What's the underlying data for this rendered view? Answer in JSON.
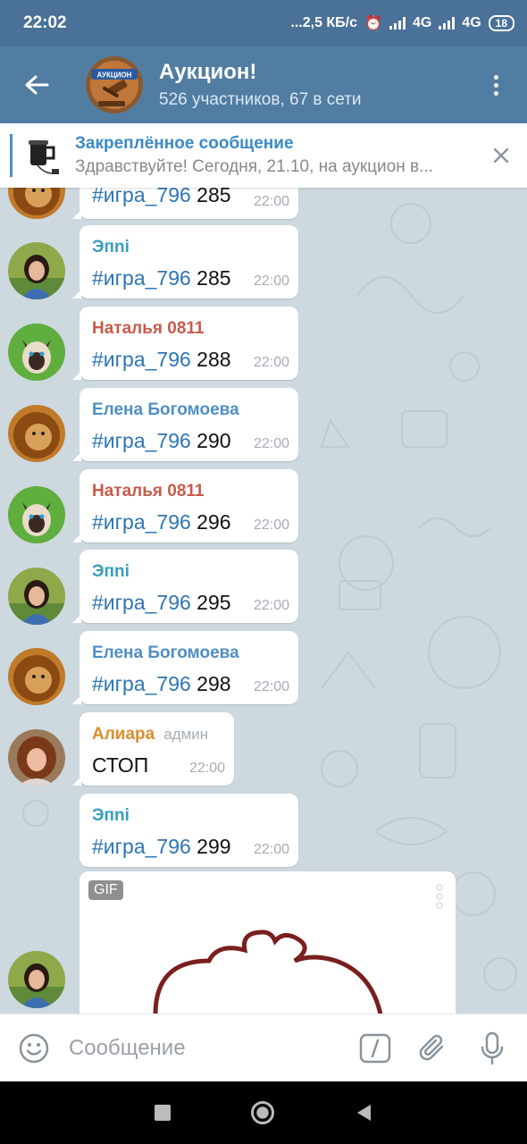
{
  "status_bar": {
    "time": "22:02",
    "net_speed": "...2,5 КБ/с",
    "net1": "4G",
    "net2": "4G",
    "battery": "18"
  },
  "header": {
    "title": "Аукцион!",
    "subtitle": "526 участников, 67 в сети",
    "avatar_text": "АУКЦИОН"
  },
  "pinned": {
    "title": "Закреплённое сообщение",
    "text": "Здравствуйте! Сегодня, 21.10, на аукцион в..."
  },
  "messages": [
    {
      "tag": "#игра_796",
      "value": "285",
      "time": "22:00"
    },
    {
      "sender": "Эпni",
      "tag": "#игра_796",
      "value": "285",
      "time": "22:00"
    },
    {
      "sender": "Наталья 0811",
      "tag": "#игра_796",
      "value": "288",
      "time": "22:00"
    },
    {
      "sender": "Елена Богомоева",
      "tag": "#игра_796",
      "value": "290",
      "time": "22:00"
    },
    {
      "sender": "Наталья 0811",
      "tag": "#игра_796",
      "value": "296",
      "time": "22:00"
    },
    {
      "sender": "Эпni",
      "tag": "#игра_796",
      "value": "295",
      "time": "22:00"
    },
    {
      "sender": "Елена Богомоева",
      "tag": "#игра_796",
      "value": "298",
      "time": "22:00"
    },
    {
      "sender": "Алиара",
      "role": "админ",
      "text": "СТОП",
      "time": "22:00"
    },
    {
      "sender": "Эпni",
      "tag": "#игра_796",
      "value": "299",
      "time": "22:00"
    }
  ],
  "gif": {
    "badge": "GIF"
  },
  "input": {
    "placeholder": "Сообщение"
  },
  "colors": {
    "header_bg": "#517da2",
    "status_bg": "#4a7197",
    "sender_teal": "#3a9dbf",
    "sender_red": "#c95a4a",
    "sender_blue": "#4f8ec4",
    "sender_orange": "#d98e2e",
    "hashtag": "#2d75b4"
  }
}
